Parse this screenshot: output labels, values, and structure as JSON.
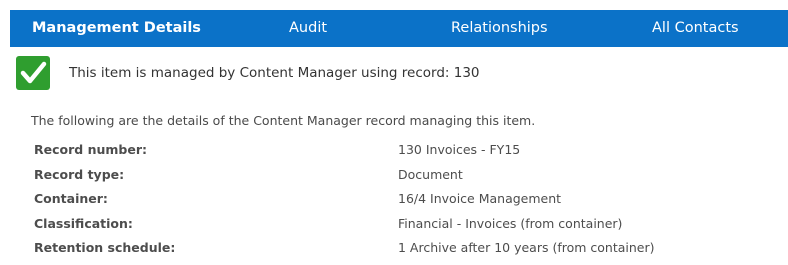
{
  "tabs": [
    {
      "label": "Management Details",
      "active": true
    },
    {
      "label": "Audit",
      "active": false
    },
    {
      "label": "Relationships",
      "active": false
    },
    {
      "label": "All Contacts",
      "active": false
    }
  ],
  "colors": {
    "tab_bar": "#0b72c8",
    "check_badge": "#2f9e2f"
  },
  "status": {
    "icon": "checkmark-icon",
    "text": "This item is managed by Content Manager using record: 130"
  },
  "intro": "The following are the details of the Content Manager record managing this item.",
  "details": [
    {
      "label": "Record number:",
      "value": "130 Invoices - FY15"
    },
    {
      "label": "Record type:",
      "value": "Document"
    },
    {
      "label": "Container:",
      "value": "16/4 Invoice Management"
    },
    {
      "label": "Classification:",
      "value": "Financial - Invoices (from container)"
    },
    {
      "label": "Retention schedule:",
      "value": "1 Archive after 10 years (from container)"
    }
  ]
}
